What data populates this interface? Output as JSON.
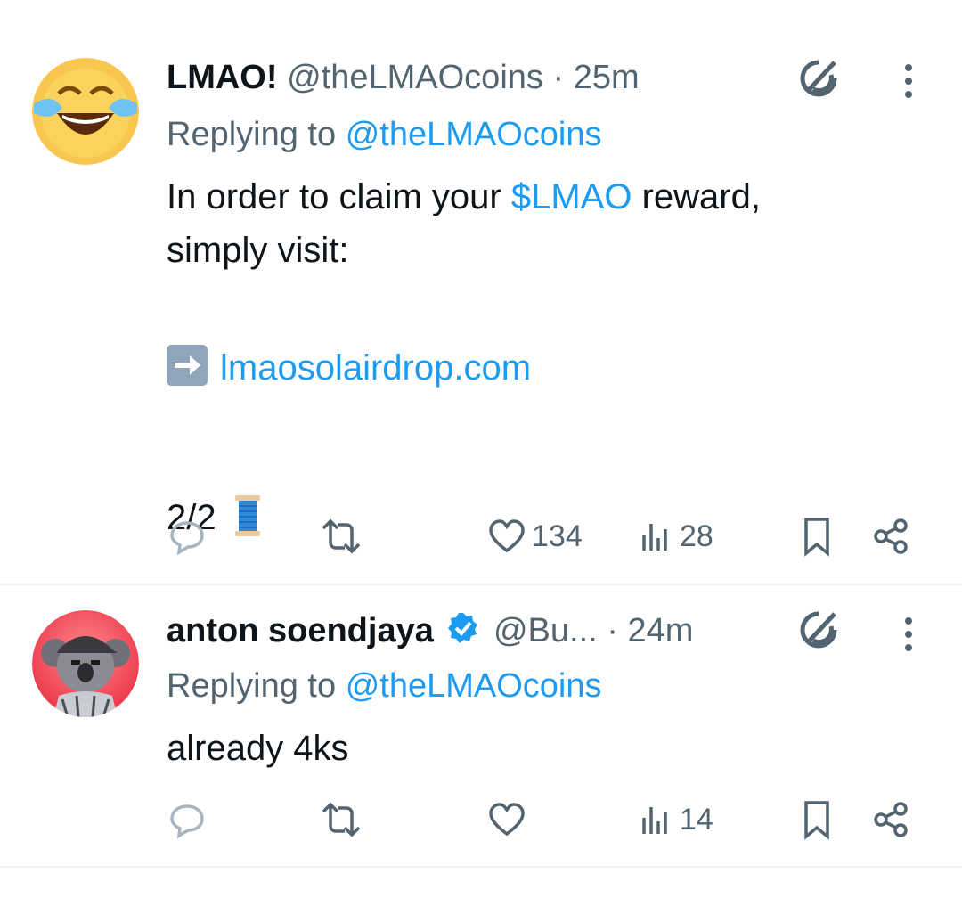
{
  "tweets": [
    {
      "name": "LMAO!",
      "handle": "@theLMAOcoins",
      "dot": "·",
      "time": "25m",
      "verified": false,
      "replying_prefix": "Replying to",
      "replying_handle": "@theLMAOcoins",
      "body": {
        "line1_prefix": "In order to claim your",
        "line1_link": "$LMAO",
        "line1_suffix": "reward,",
        "line2": "simply visit:",
        "url": "lmaosolairdrop.com",
        "thread_count": "2/2"
      },
      "stats": {
        "likes": "134",
        "views": "28"
      }
    },
    {
      "name": "anton soendjaya",
      "handle": "@Bu...",
      "dot": "·",
      "time": "24m",
      "verified": true,
      "replying_prefix": "Replying to",
      "replying_handle": "@theLMAOcoins",
      "body": {
        "text": "already 4ks"
      },
      "stats": {
        "likes": "",
        "views": "14"
      }
    }
  ],
  "colors": {
    "link": "#1d9bf0",
    "secondary": "#536471",
    "verified": "#1d9bf0",
    "avatar1_bg": "#f9c74f",
    "avatar2_bg": "#f0445a"
  },
  "icons": [
    "grok-icon",
    "more-options-icon",
    "reply-icon",
    "retweet-icon",
    "like-icon",
    "views-icon",
    "bookmark-icon",
    "share-icon",
    "verified-badge-icon",
    "arrow-right-emoji",
    "thread-spool-emoji"
  ]
}
